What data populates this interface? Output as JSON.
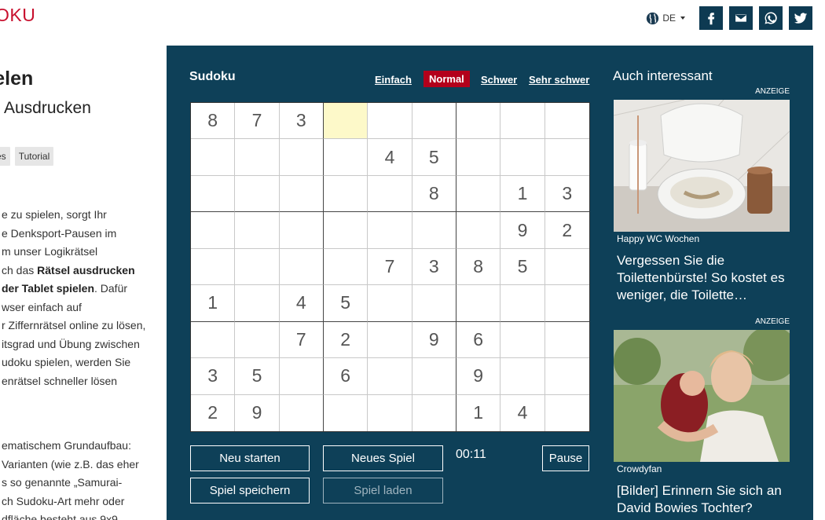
{
  "header": {
    "logo_text": "OKU",
    "language": "DE",
    "social": [
      "facebook-icon",
      "mail-icon",
      "whatsapp-icon",
      "twitter-icon"
    ]
  },
  "left": {
    "heading": "pielen",
    "subheading": "Ausdrucken",
    "tags": [
      "es",
      "Tutorial"
    ],
    "para1": [
      {
        "t": "e zu spielen, sorgt Ihr"
      },
      {
        "t": "e Denksport-Pausen im"
      },
      {
        "t": "m unser Logikrätsel"
      },
      {
        "t": "ch das ",
        "b": "Rätsel ausdrucken"
      },
      {
        "b": "der Tablet spielen",
        "t2": ". Dafür"
      },
      {
        "t": "wser einfach auf"
      },
      {
        "t": "r Ziffernrätsel online zu lösen,"
      },
      {
        "t": "itsgrad und Übung zwischen"
      },
      {
        "t": "udoku spielen, werden Sie"
      },
      {
        "t": "enrätsel schneller lösen"
      }
    ],
    "para2": [
      "ematischem Grundaufbau:",
      "Varianten (wie z.B. das eher",
      "s so genannte „Samurai-",
      "ch Sudoku-Art mehr oder",
      "dfläche besteht aus 9x9"
    ]
  },
  "game": {
    "title": "Sudoku",
    "levels": [
      "Einfach",
      "Normal",
      "Schwer",
      "Sehr schwer"
    ],
    "active_level": "Normal",
    "grid": [
      [
        "8",
        "7",
        "3",
        "",
        "",
        "",
        "",
        "",
        ""
      ],
      [
        "",
        "",
        "",
        "",
        "4",
        "5",
        "",
        "",
        ""
      ],
      [
        "",
        "",
        "",
        "",
        "",
        "8",
        "",
        "1",
        "3"
      ],
      [
        "",
        "",
        "",
        "",
        "",
        "",
        "",
        "9",
        "2"
      ],
      [
        "",
        "",
        "",
        "",
        "7",
        "3",
        "8",
        "5",
        ""
      ],
      [
        "1",
        "",
        "4",
        "5",
        "",
        "",
        "",
        "",
        ""
      ],
      [
        "",
        "",
        "7",
        "2",
        "",
        "9",
        "6",
        "",
        ""
      ],
      [
        "3",
        "5",
        "",
        "6",
        "",
        "",
        "9",
        "",
        ""
      ],
      [
        "2",
        "9",
        "",
        "",
        "",
        "",
        "1",
        "4",
        ""
      ]
    ],
    "selected_cell": [
      0,
      3
    ],
    "buttons": {
      "restart": "Neu starten",
      "new_game": "Neues Spiel",
      "pause": "Pause",
      "save": "Spiel speichern",
      "load": "Spiel laden"
    },
    "timer": "00:11"
  },
  "sidebar": {
    "title": "Auch interessant",
    "ads": [
      {
        "label": "ANZEIGE",
        "source": "Happy WC Wochen",
        "title": "Vergessen Sie die Toilettenbürste! So kostet es weniger, die Toilette…"
      },
      {
        "label": "ANZEIGE",
        "source": "Crowdyfan",
        "title": "[Bilder] Erinnern Sie sich an David Bowies Tochter?"
      }
    ]
  },
  "colors": {
    "panel": "#0e4058",
    "accent": "#b3001b",
    "logo": "#c8102e",
    "selected_cell": "#fdf9c9"
  }
}
